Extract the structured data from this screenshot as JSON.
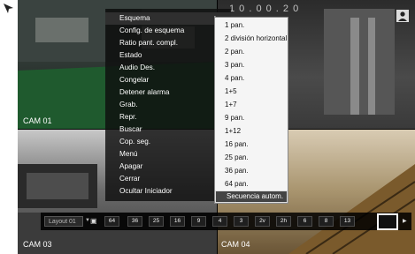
{
  "cameras": [
    {
      "label": "CAM 01"
    },
    {
      "label": "CAM 03"
    },
    {
      "label": "CAM 04"
    }
  ],
  "top_digits": "1 0 . 0 0 . 2 0",
  "main_menu": {
    "items": [
      {
        "label": "Esquema",
        "submenu": true
      },
      {
        "label": "Config. de esquema",
        "submenu": true
      },
      {
        "label": "Ratio pant. compl.",
        "submenu": false
      },
      {
        "label": "Estado",
        "submenu": true
      },
      {
        "label": "Audio Des.",
        "submenu": false
      },
      {
        "label": "Congelar",
        "submenu": false
      },
      {
        "label": "Detener alarma",
        "submenu": false
      },
      {
        "label": "Grab.",
        "submenu": false
      },
      {
        "label": "Repr.",
        "submenu": false
      },
      {
        "label": "Buscar",
        "submenu": false
      },
      {
        "label": "Cop. seg.",
        "submenu": false
      },
      {
        "label": "Menú",
        "submenu": false
      },
      {
        "label": "Apagar",
        "submenu": false
      },
      {
        "label": "Cerrar",
        "submenu": false
      },
      {
        "label": "Ocultar Iniciador",
        "submenu": false
      }
    ],
    "arrow_glyph": "▶"
  },
  "sub_menu": {
    "items": [
      "1 pan.",
      "2 división horizontal",
      "2 pan.",
      "3 pan.",
      "4 pan.",
      "1+5",
      "1+7",
      "9 pan.",
      "1+12",
      "16 pan.",
      "25 pan.",
      "36 pan.",
      "64 pan."
    ],
    "selected": "Secuencia autom."
  },
  "toolbar": {
    "layout_label": "Layout 01",
    "buttons": [
      "64",
      "36",
      "25",
      "16",
      "9",
      "4",
      "3",
      "2v",
      "2h",
      "6",
      "8",
      "13"
    ]
  }
}
